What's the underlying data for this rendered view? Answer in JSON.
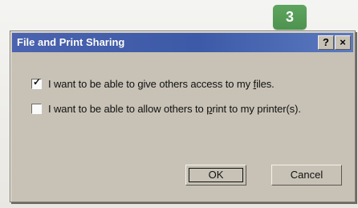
{
  "step_badge": "3",
  "dialog": {
    "title": "File and Print Sharing",
    "help_button": "?",
    "close_button": "×",
    "checkbox_1": {
      "checked": true,
      "mark": "✓",
      "label_before": "I want to be able to give others access to my ",
      "label_underlined": "f",
      "label_after": "iles."
    },
    "checkbox_2": {
      "checked": false,
      "mark": "",
      "label_before": "I want to be able to allow others to ",
      "label_underlined": "p",
      "label_after": "rint to my printer(s)."
    },
    "ok_label": "OK",
    "cancel_label": "Cancel"
  },
  "colors": {
    "titlebar": "#3c5aa7",
    "dialog": "#c8c2b6",
    "badge": "#4d934f"
  }
}
